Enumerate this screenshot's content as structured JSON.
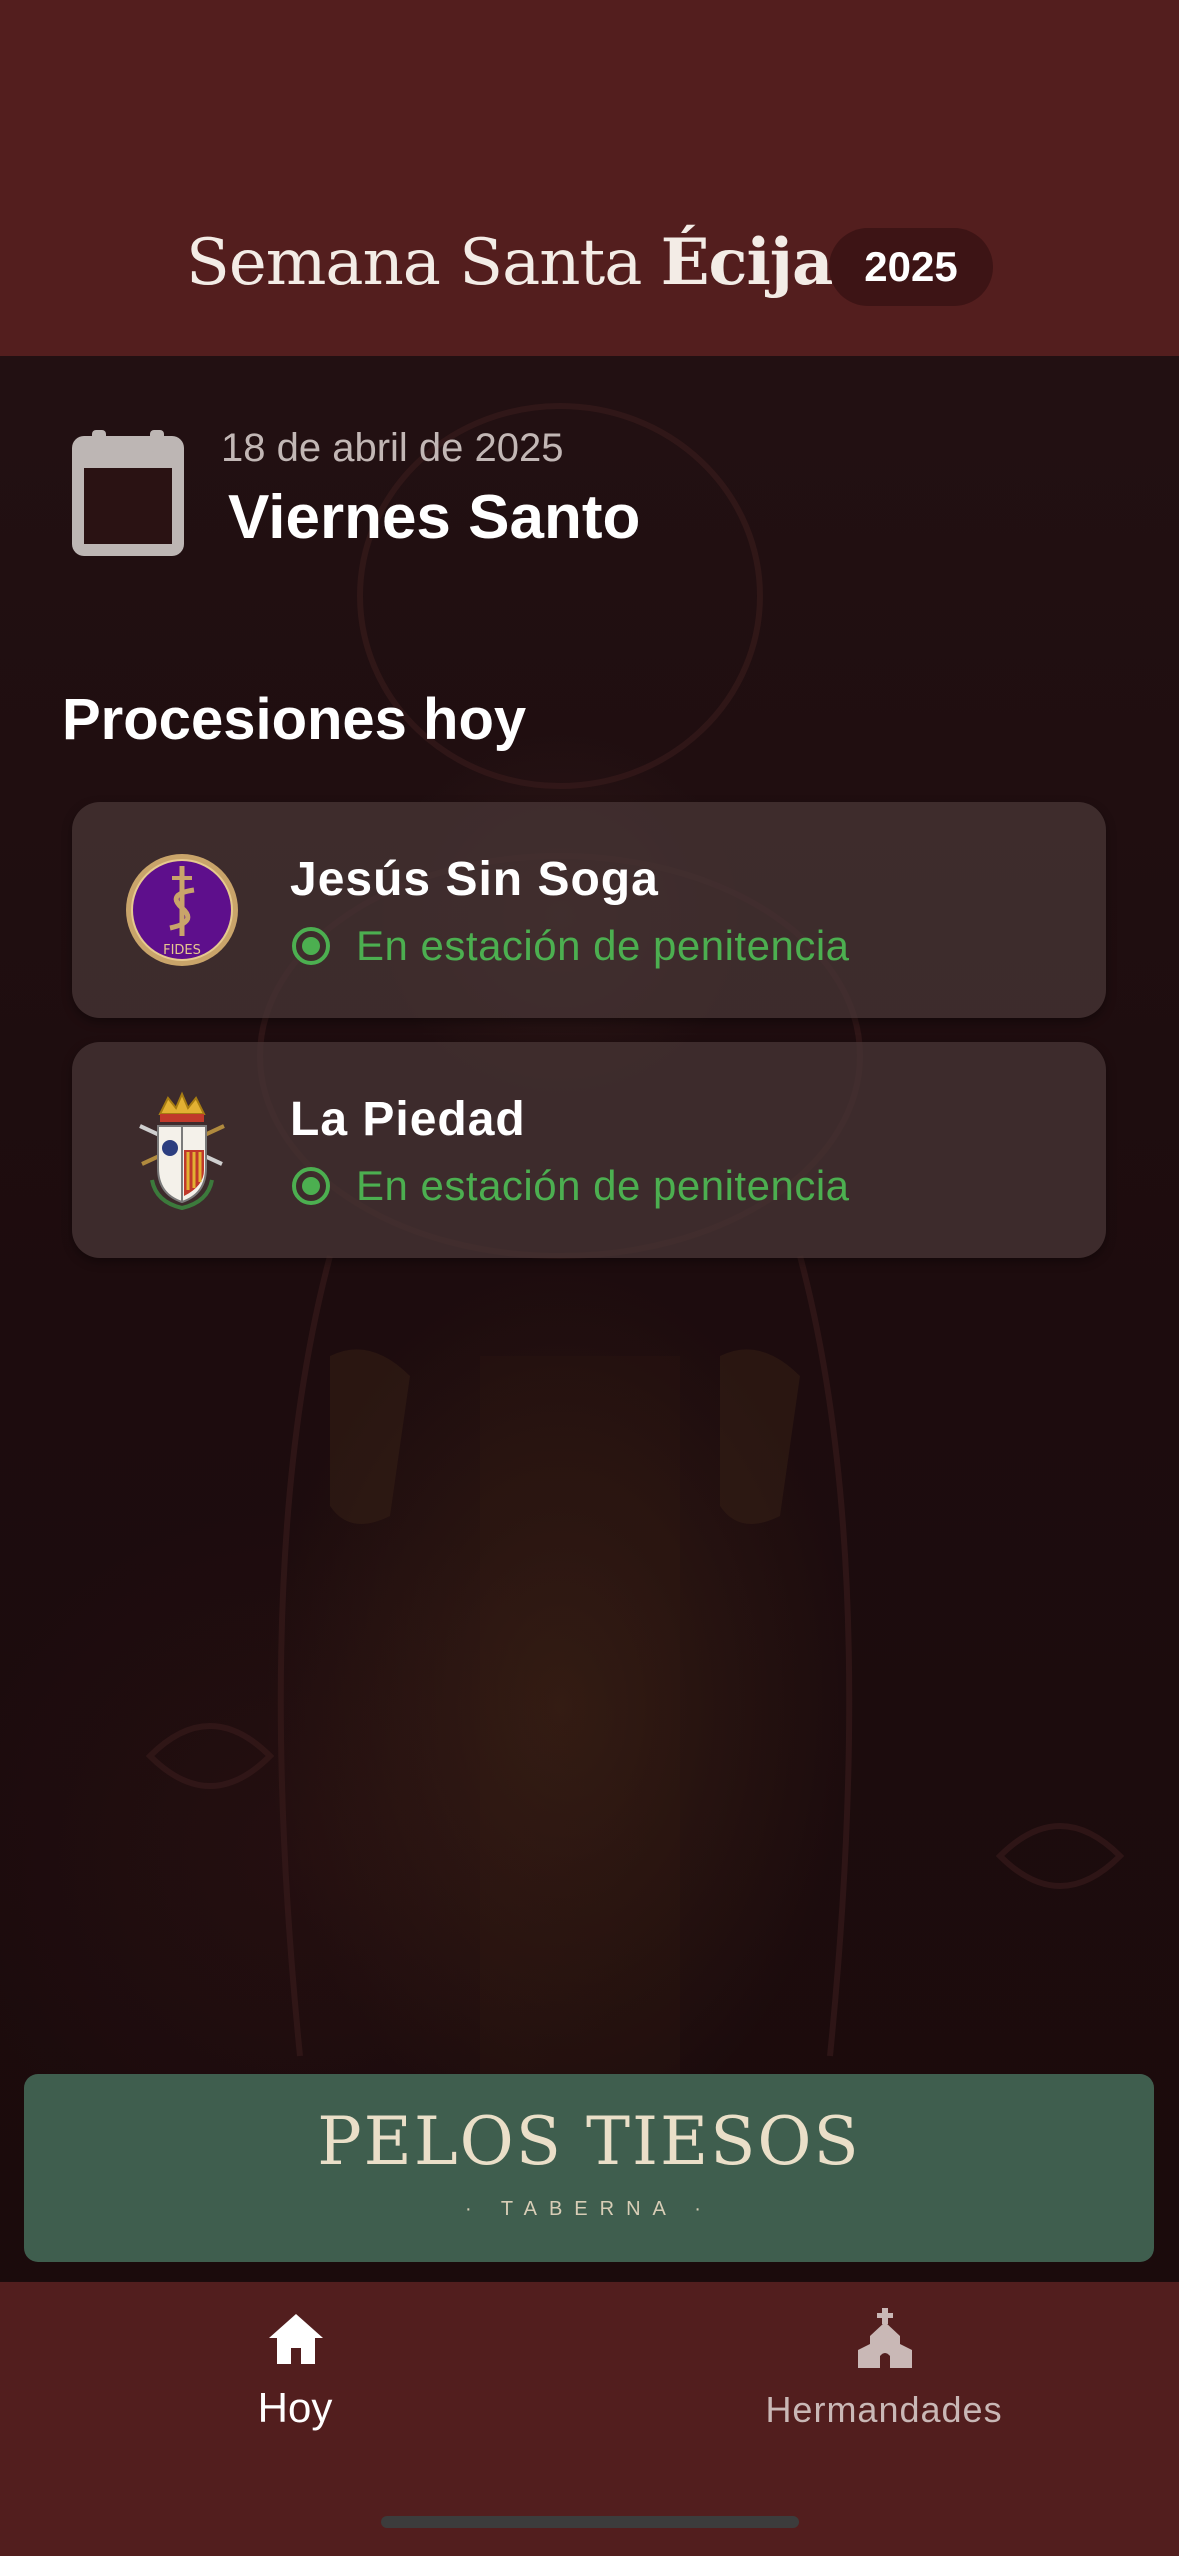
{
  "header": {
    "title_light": "Semana Santa",
    "title_bold": "Écija",
    "year_badge": "2025"
  },
  "today": {
    "day_number": "18",
    "date_rest": " de abril de 2025",
    "day_name": "Viernes Santo",
    "icon": "calendar-icon"
  },
  "processions": {
    "title": "Procesiones hoy",
    "items": [
      {
        "name": "Jesús Sin Soga",
        "status": "En estación de penitencia",
        "crest_text": "FIDES",
        "crest_color": "#5e0f8c"
      },
      {
        "name": "La Piedad",
        "status": "En estación de penitencia",
        "crest_color": "#c0392b"
      }
    ],
    "status_color": "#4caf50"
  },
  "sponsor": {
    "name": "PELOS TIESOS",
    "subtitle": "· TABERNA ·",
    "background": "#3f5e4e"
  },
  "bottom_nav": {
    "items": [
      {
        "label": "Hoy",
        "icon": "home-icon",
        "active": true
      },
      {
        "label": "Hermandades",
        "icon": "church-icon",
        "active": false
      }
    ]
  },
  "colors": {
    "header_bg": "#531e1e",
    "nav_bg": "#521e1e",
    "card_bg": "#463434"
  }
}
